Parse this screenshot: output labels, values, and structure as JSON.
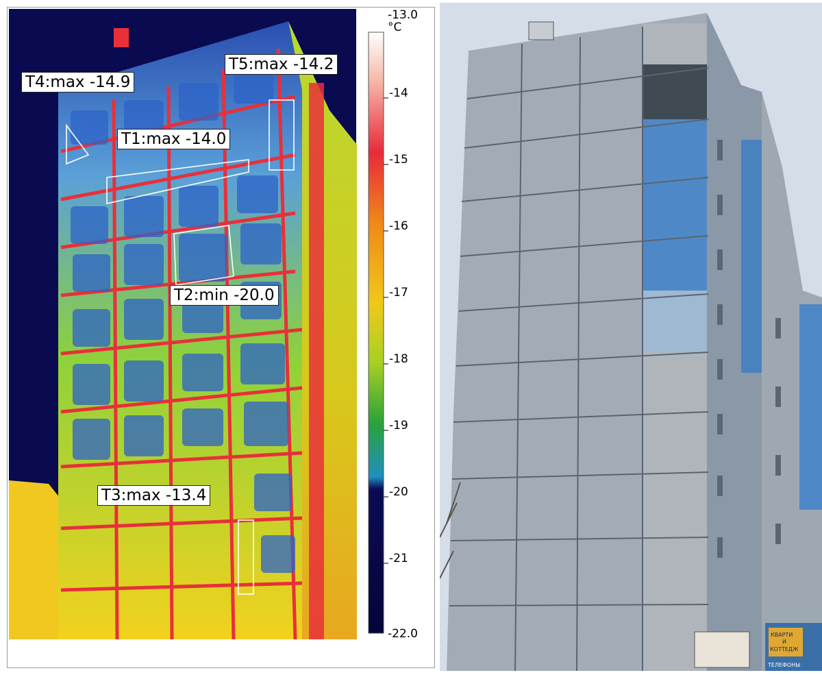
{
  "thermogram": {
    "labels": [
      {
        "id": "T4",
        "text": "T4:max -14.9"
      },
      {
        "id": "T5",
        "text": "T5:max -14.2"
      },
      {
        "id": "T1",
        "text": "T1:max -14.0"
      },
      {
        "id": "T2",
        "text": "T2:min -20.0"
      },
      {
        "id": "T3",
        "text": "T3:max -13.4"
      }
    ],
    "scale": {
      "top": "-13.0 °C",
      "ticks": [
        "-14",
        "-15",
        "-16",
        "-17",
        "-18",
        "-19",
        "-20",
        "-21"
      ],
      "bottom": "-22.0"
    },
    "colors": {
      "background": "#0a0a55",
      "cold": "#2a6fd0",
      "mid": "#7fd050",
      "warm": "#f2d020",
      "hot": "#e83030"
    }
  },
  "photo": {
    "sign_text": [
      "КВАРТИ",
      "И",
      "КОТТЕДЖ",
      "ТЕЛЕФОНЫ"
    ],
    "colors": {
      "sky": "#d6dde8",
      "panel": "#a9b2bd",
      "blue": "#4a86c8"
    }
  }
}
